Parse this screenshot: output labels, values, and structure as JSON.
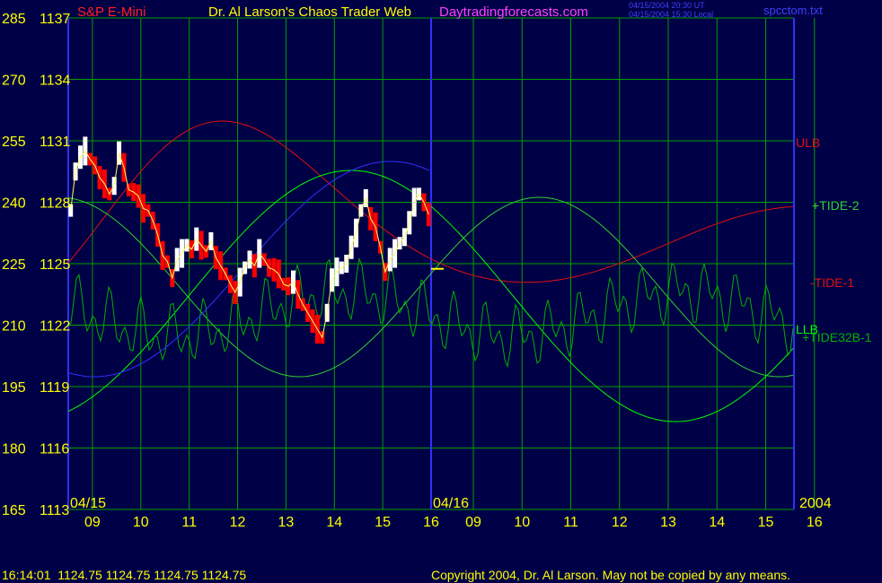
{
  "header": {
    "symbol": "S&P E-Mini",
    "title": "Dr. Al Larson's Chaos Trader Web",
    "site": "Daytradingforecasts.com",
    "stamp_utc": "04/15/2004 20:30 UT",
    "stamp_local": "04/15/2004 15:30 Local",
    "file": "spcctom.txt"
  },
  "footer": {
    "readout": "16:14:01  1124.75 1124.75 1124.75 1124.75",
    "copyright": "Copyright 2004, Dr. Al Larson. May not be copied by any means."
  },
  "colors": {
    "background": "#000046",
    "grid": "#00a000",
    "yellow_text": "#ffff00",
    "price_up": "#ffffff",
    "price_down": "#ff0000",
    "ulb": "#e01010",
    "tide2": "#30d030",
    "tide1": "#00ff00",
    "tide32b": "#00b000",
    "blue_line": "#3030ff",
    "title_magenta": "#ff40ff"
  },
  "chart_data": {
    "type": "line",
    "title": "Dr. Al Larson's Chaos Trader Web",
    "y_left_outer_ticks": [
      "285",
      "270",
      "255",
      "240",
      "225",
      "210",
      "195",
      "180",
      "165"
    ],
    "y_left_inner_ticks": [
      "1137",
      "1134",
      "1131",
      "1128",
      "1125",
      "1122",
      "1119",
      "1116",
      "1113"
    ],
    "ylim": [
      1113,
      1137
    ],
    "x_hour_ticks": [
      "09",
      "10",
      "11",
      "12",
      "13",
      "14",
      "15",
      "16",
      "09",
      "10",
      "11",
      "12",
      "13",
      "14",
      "15",
      "16"
    ],
    "date_labels": [
      "04/15",
      "04/16",
      "2004"
    ],
    "legend": [
      "ULB",
      "+TIDE-2",
      "-TIDE-1",
      "LLB",
      "+TIDE32B-1"
    ],
    "x_range_hours": [
      8.5,
      16.0
    ],
    "price": {
      "name": "S&P E-Mini",
      "x": [
        8.55,
        8.65,
        8.75,
        8.85,
        8.95,
        9.05,
        9.15,
        9.25,
        9.35,
        9.45,
        9.55,
        9.65,
        9.75,
        9.85,
        9.95,
        10.05,
        10.15,
        10.25,
        10.35,
        10.45,
        10.55,
        10.65,
        10.75,
        10.85,
        10.95,
        11.05,
        11.15,
        11.25,
        11.35,
        11.45,
        11.55,
        11.65,
        11.75,
        11.85,
        11.95,
        12.05,
        12.15,
        12.25,
        12.35,
        12.45,
        12.55,
        12.65,
        12.75,
        12.85,
        12.95,
        13.05,
        13.15,
        13.25,
        13.35,
        13.45,
        13.55,
        13.65,
        13.75,
        13.85,
        13.95,
        14.05,
        14.15,
        14.25,
        14.35,
        14.45,
        14.55,
        14.65,
        14.75,
        14.85,
        14.95,
        15.05,
        15.15,
        15.25,
        15.35,
        15.45,
        15.55,
        15.65,
        15.75,
        15.85,
        15.95
      ],
      "close": [
        1127.6,
        1129.5,
        1130.2,
        1130.5,
        1130.1,
        1129.8,
        1129.2,
        1128.9,
        1128.4,
        1128.8,
        1130.4,
        1129.7,
        1128.6,
        1128.5,
        1128.3,
        1127.7,
        1127.6,
        1127.1,
        1126.4,
        1125.4,
        1125.1,
        1124.3,
        1125.2,
        1125.5,
        1125.9,
        1125.7,
        1126.2,
        1125.9,
        1125.6,
        1126.1,
        1125.3,
        1124.9,
        1124.5,
        1124.0,
        1123.6,
        1124.1,
        1124.8,
        1125.2,
        1124.9,
        1125.5,
        1125.2,
        1124.8,
        1124.7,
        1124.5,
        1124.0,
        1123.9,
        1124.1,
        1123.5,
        1123.0,
        1122.6,
        1122.2,
        1121.8,
        1121.4,
        1122.6,
        1124.2,
        1124.6,
        1124.8,
        1125.0,
        1125.8,
        1126.5,
        1127.6,
        1128.2,
        1127.2,
        1126.8,
        1125.8,
        1124.6,
        1125.2,
        1125.5,
        1126.0,
        1126.3,
        1127.0,
        1128.0,
        1128.4,
        1128.0,
        1127.4
      ]
    },
    "markers": {
      "last_price": 1124.75
    }
  }
}
